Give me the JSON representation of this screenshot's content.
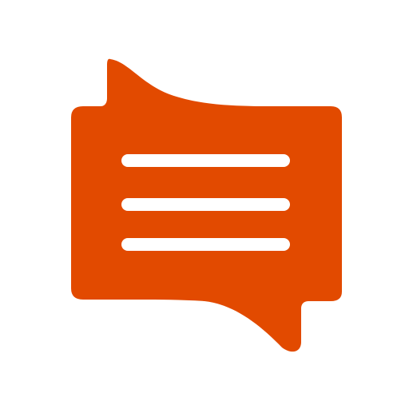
{
  "logo": {
    "name": "chat-bubble-menu-icon",
    "colors": {
      "background": "#ffffff",
      "bubble": "#e24a00",
      "lines": "#ffffff"
    },
    "line_count": 3
  }
}
